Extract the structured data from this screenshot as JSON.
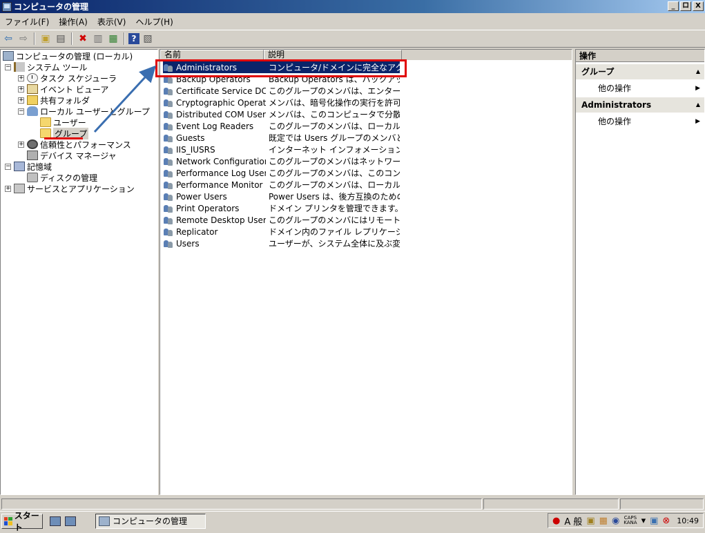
{
  "window": {
    "title": "コンピュータの管理",
    "buttons": [
      "_",
      "ロ",
      "X"
    ]
  },
  "menu": [
    "ファイル(F)",
    "操作(A)",
    "表示(V)",
    "ヘルプ(H)"
  ],
  "tree": {
    "root": "コンピュータの管理 (ローカル)",
    "system_tools": "システム ツール",
    "task_scheduler": "タスク スケジューラ",
    "event_viewer": "イベント ビューア",
    "shared_folders": "共有フォルダ",
    "local_users_groups": "ローカル ユーザーとグループ",
    "users": "ユーザー",
    "groups": "グループ",
    "reliability": "信頼性とパフォーマンス",
    "device_manager": "デバイス マネージャ",
    "storage": "記憶域",
    "disk_management": "ディスクの管理",
    "services_apps": "サービスとアプリケーション"
  },
  "list": {
    "columns": [
      "名前",
      "説明"
    ],
    "rows": [
      {
        "name": "Administrators",
        "desc": "コンピュータ/ドメインに完全なアクセス..."
      },
      {
        "name": "Backup Operators",
        "desc": "Backup Operators は、バックアップの..."
      },
      {
        "name": "Certificate Service DC...",
        "desc": "このグループのメンバは、エンタープライ..."
      },
      {
        "name": "Cryptographic Operators",
        "desc": "メンバは、暗号化操作の実行を許可さ..."
      },
      {
        "name": "Distributed COM Users",
        "desc": "メンバは、このコンピュータで分散 COM ..."
      },
      {
        "name": "Event Log Readers",
        "desc": "このグループのメンバは、ローカル コンピ..."
      },
      {
        "name": "Guests",
        "desc": "既定では Users グループのメンバと同..."
      },
      {
        "name": "IIS_IUSRS",
        "desc": "インターネット インフォメーション サービ..."
      },
      {
        "name": "Network Configuration ...",
        "desc": "このグループのメンバはネットワーク機能..."
      },
      {
        "name": "Performance Log Users",
        "desc": "このグループのメンバは、このコンピュータ..."
      },
      {
        "name": "Performance Monitor U...",
        "desc": "このグループのメンバは、ローカルやリモ..."
      },
      {
        "name": "Power Users",
        "desc": "Power Users は、後方互換のための..."
      },
      {
        "name": "Print Operators",
        "desc": "ドメイン プリンタを管理できます。"
      },
      {
        "name": "Remote Desktop Users",
        "desc": "このグループのメンバにはリモートからログ..."
      },
      {
        "name": "Replicator",
        "desc": "ドメイン内のファイル レプリケーションを..."
      },
      {
        "name": "Users",
        "desc": "ユーザーが、システム全体に及ぶ変更..."
      }
    ]
  },
  "actions": {
    "title": "操作",
    "section1": "グループ",
    "section1_item": "他の操作",
    "section2": "Administrators",
    "section2_item": "他の操作"
  },
  "taskbar": {
    "start": "スタート",
    "task": "コンピュータの管理",
    "ime": "A 般",
    "caps": "CAPS",
    "kana": "KANA",
    "clock": "10:49"
  },
  "colors": {
    "selection": "#0a246a",
    "annotation": "#e00000",
    "arrow": "#3a6eb0"
  }
}
